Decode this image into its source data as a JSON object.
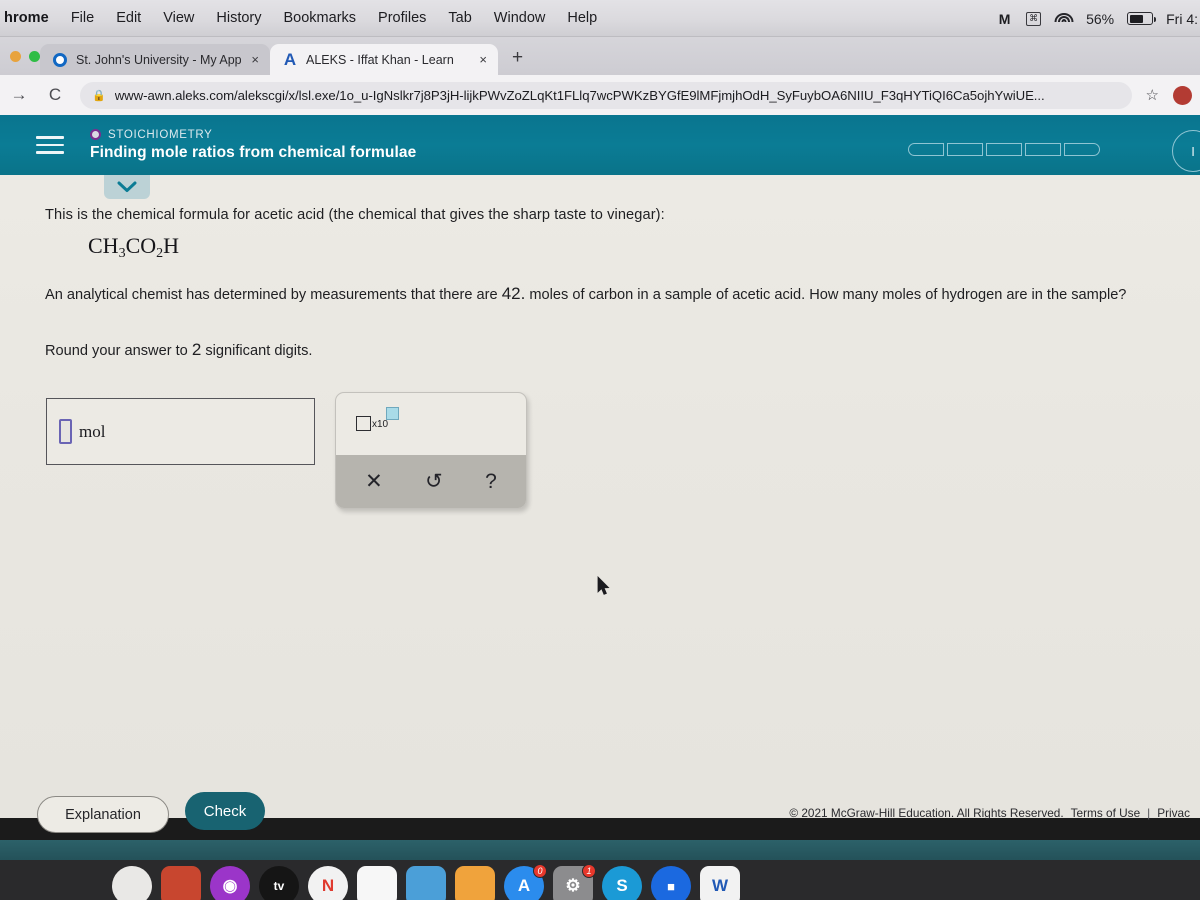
{
  "menubar": {
    "app": "hrome",
    "items": [
      "File",
      "Edit",
      "View",
      "History",
      "Bookmarks",
      "Profiles",
      "Tab",
      "Window",
      "Help"
    ],
    "status": {
      "malwarebytes_icon": "m-logo-icon",
      "command_icon": "command-key-icon",
      "wifi_icon": "wifi-icon",
      "battery_percent": "56%",
      "battery_icon": "battery-icon",
      "clock": "Fri 4:"
    }
  },
  "browser": {
    "tabs": [
      {
        "title": "St. John's University - My App",
        "favicon": "ring-icon",
        "active": false,
        "close": "×"
      },
      {
        "title": "ALEKS - Iffat Khan - Learn",
        "favicon": "aleks-a-icon",
        "active": true,
        "close": "×"
      }
    ],
    "new_tab_label": "+",
    "nav": {
      "forward": "→",
      "reload": "C"
    },
    "url": "www-awn.aleks.com/alekscgi/x/lsl.exe/1o_u-IgNslkr7j8P3jH-lijkPWvZoZLqKt1FLlq7wcPWKzBYGfE9lMFjmjhOdH_SyFuybOA6NIIU_F3qHYTiQI6Ca5ojhYwiUE...",
    "lock_icon": "lock-icon",
    "star_icon": "star-icon",
    "profile_icon": "profile-avatar-icon"
  },
  "aleks_header": {
    "menu_icon": "hamburger-icon",
    "topic": "STOICHIOMETRY",
    "topic_dot_color": "#7b2d8e",
    "subject": "Finding mole ratios from chemical formulae",
    "progress_segments": 5,
    "avatar_icon": "profile-circle-icon",
    "background_color": "#0b7c95"
  },
  "question": {
    "collapse_icon": "chevron-down-icon",
    "intro": "This is the chemical formula for acetic acid (the chemical that gives the sharp taste to vinegar):",
    "formula": {
      "parts": [
        "CH",
        "3",
        "CO",
        "2",
        "H"
      ]
    },
    "body_before": "An analytical chemist has determined by measurements that there are ",
    "carbon_moles": "42.",
    "body_after": " moles of carbon in a sample of acetic acid. How many moles of hydrogen are in the sample?",
    "round_before": "Round your answer to ",
    "sig_digits": "2",
    "round_after": " significant digits.",
    "answer": {
      "value": "",
      "unit": "mol",
      "placeholder_icon": "text-cursor-placeholder-icon"
    }
  },
  "palette": {
    "sci_notation": {
      "base_icon": "empty-box-icon",
      "label": "x10",
      "exponent_icon": "exponent-box-icon"
    },
    "buttons": [
      {
        "name": "clear-button",
        "glyph": "✕"
      },
      {
        "name": "undo-button",
        "glyph": "↺"
      },
      {
        "name": "help-button",
        "glyph": "?"
      }
    ]
  },
  "actions": {
    "explanation_label": "Explanation",
    "check_label": "Check",
    "check_color": "#186371"
  },
  "footer": {
    "copyright": "© 2021 McGraw-Hill Education. All Rights Reserved.",
    "terms": "Terms of Use",
    "separator": "|",
    "privacy": "Privac"
  },
  "dock": {
    "icons": [
      {
        "name": "dock-icon-app1",
        "color": "#e9e8e6",
        "glyph": "",
        "round": true,
        "badge": ""
      },
      {
        "name": "dock-icon-photos",
        "color": "#c8462f",
        "glyph": "",
        "round": false,
        "badge": ""
      },
      {
        "name": "dock-icon-podcasts",
        "color": "#9b35c9",
        "glyph": "◉",
        "round": true,
        "badge": ""
      },
      {
        "name": "dock-icon-appletv",
        "color": "#151515",
        "glyph": "tv",
        "round": true,
        "badge": ""
      },
      {
        "name": "dock-icon-news",
        "color": "#f2f2f2",
        "glyph": "N",
        "round": true,
        "badge": ""
      },
      {
        "name": "dock-icon-numbers",
        "color": "#f7f7f7",
        "glyph": "",
        "round": false,
        "badge": ""
      },
      {
        "name": "dock-icon-keynote",
        "color": "#4b9fd8",
        "glyph": "",
        "round": false,
        "badge": ""
      },
      {
        "name": "dock-icon-pages",
        "color": "#f0a33c",
        "glyph": "",
        "round": false,
        "badge": ""
      },
      {
        "name": "dock-icon-appstore",
        "color": "#2b8ced",
        "glyph": "A",
        "round": true,
        "badge": "0"
      },
      {
        "name": "dock-icon-settings",
        "color": "#8c8c8e",
        "glyph": "⚙",
        "round": false,
        "badge": "1"
      },
      {
        "name": "dock-icon-skype",
        "color": "#1b9ad6",
        "glyph": "S",
        "round": true,
        "badge": ""
      },
      {
        "name": "dock-icon-zoom",
        "color": "#1b69e0",
        "glyph": "■",
        "round": true,
        "badge": ""
      },
      {
        "name": "dock-icon-word",
        "color": "#f2f2f2",
        "glyph": "W",
        "round": false,
        "badge": ""
      }
    ]
  }
}
